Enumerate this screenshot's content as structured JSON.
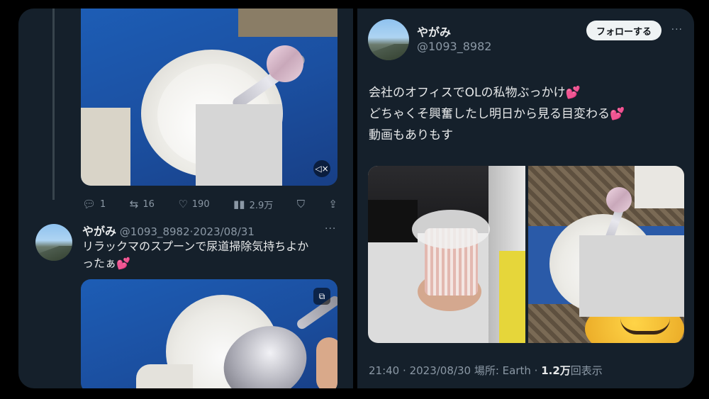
{
  "left_panel": {
    "first_tweet_actions": {
      "replies": "1",
      "retweets": "16",
      "likes": "190",
      "views": "2.9万"
    },
    "reply_tweet": {
      "name": "やがみ",
      "handle": "@1093_8982",
      "separator": "·",
      "date": "2023/08/31",
      "text_line1": "リラックマのスプーンで尿道掃除気持ちよか",
      "text_line2": "ったぁ",
      "emoji": "💕"
    }
  },
  "right_panel": {
    "name": "やがみ",
    "handle": "@1093_8982",
    "follow_label": "フォローする",
    "more": "···",
    "lines": [
      "会社のオフィスでOLの私物ぶっかけ",
      "どちゃくそ興奮したし明日から見る目変わる",
      "動画もありもす"
    ],
    "emoji": "💕",
    "meta": {
      "time": "21:40",
      "separator": "·",
      "date": "2023/08/30",
      "location": "場所: Earth",
      "views_number": "1.2万",
      "views_label": "回表示"
    }
  },
  "icons": {
    "reply": "reply-icon",
    "retweet": "retweet-icon",
    "like": "heart-icon",
    "views": "views-icon",
    "bookmark": "bookmark-icon",
    "share": "share-icon",
    "mute": "mute-icon",
    "gif": "media-badge-icon"
  }
}
